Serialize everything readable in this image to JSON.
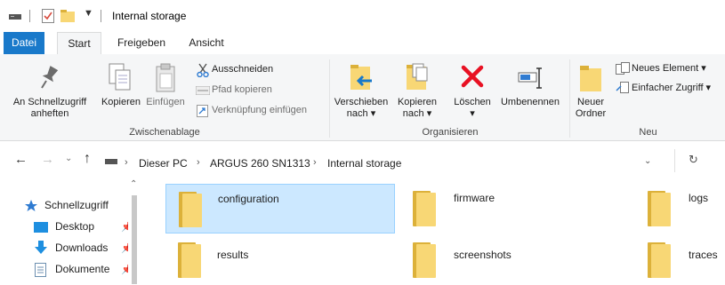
{
  "window": {
    "title": "Internal storage"
  },
  "ribbon_tabs": [
    {
      "label": "Datei"
    },
    {
      "label": "Start"
    },
    {
      "label": "Freigeben"
    },
    {
      "label": "Ansicht"
    }
  ],
  "ribbon": {
    "pin_quick_access": {
      "line1": "An Schnellzugriff",
      "line2": "anheften"
    },
    "copy": "Kopieren",
    "paste": "Einfügen",
    "cut": "Ausschneiden",
    "copy_path": "Pfad kopieren",
    "paste_shortcut": "Verknüpfung einfügen",
    "clipboard_group": "Zwischenablage",
    "move_to": {
      "line1": "Verschieben",
      "line2": "nach ▾"
    },
    "copy_to": {
      "line1": "Kopieren",
      "line2": "nach ▾"
    },
    "delete": "Löschen",
    "rename": "Umbenennen",
    "organize_group": "Organisieren",
    "new_folder": {
      "line1": "Neuer",
      "line2": "Ordner"
    },
    "new_item": "Neues Element ▾",
    "easy_access": "Einfacher Zugriff ▾",
    "new_group": "Neu"
  },
  "address": {
    "crumbs": [
      "Dieser PC",
      "ARGUS 260 SN1313",
      "Internal storage"
    ]
  },
  "nav": {
    "quick_access": "Schnellzugriff",
    "items": [
      {
        "label": "Desktop"
      },
      {
        "label": "Downloads"
      },
      {
        "label": "Dokumente"
      }
    ]
  },
  "files": [
    {
      "name": "configuration",
      "selected": true
    },
    {
      "name": "firmware",
      "selected": false
    },
    {
      "name": "logs",
      "selected": false
    },
    {
      "name": "results",
      "selected": false
    },
    {
      "name": "screenshots",
      "selected": false
    },
    {
      "name": "traces",
      "selected": false
    }
  ],
  "colors": {
    "accent": "#1979ca",
    "selection": "#cce8ff",
    "folder": "#f8d775",
    "delete_red": "#e81123"
  }
}
